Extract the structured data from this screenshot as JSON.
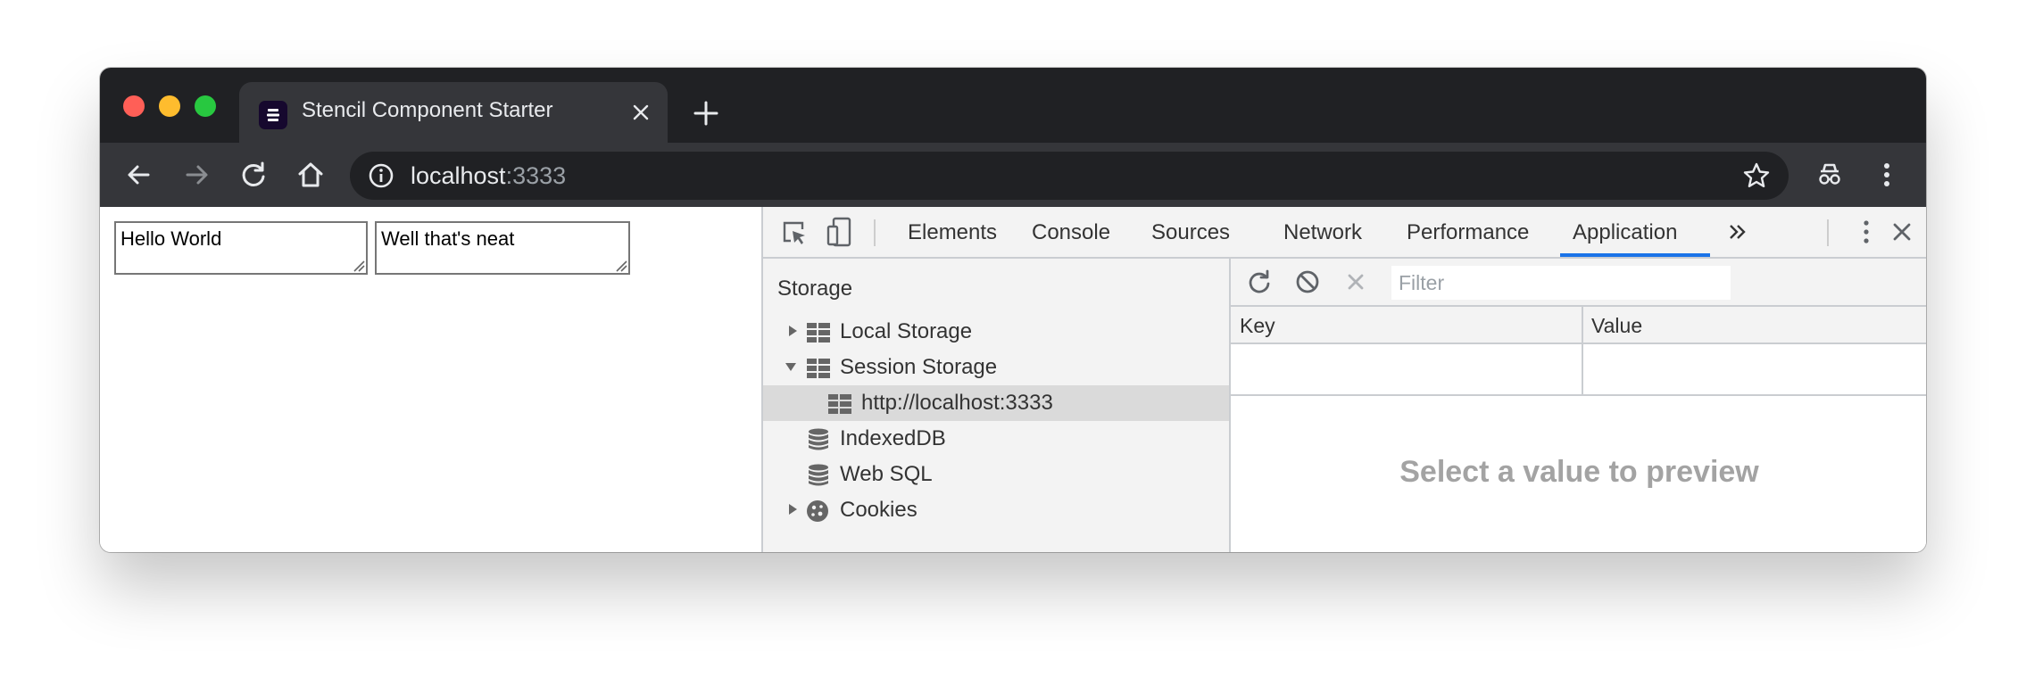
{
  "browser": {
    "tab_title": "Stencil Component Starter",
    "url_host": "localhost",
    "url_port": ":3333"
  },
  "page": {
    "textarea1_value": "Hello World",
    "textarea2_value": "Well that's neat"
  },
  "devtools": {
    "tabs": [
      "Elements",
      "Console",
      "Sources",
      "Network",
      "Performance",
      "Application"
    ],
    "active_tab": "Application",
    "sidebar": {
      "heading": "Storage",
      "items": [
        {
          "label": "Local Storage"
        },
        {
          "label": "Session Storage"
        },
        {
          "label": "http://localhost:3333"
        },
        {
          "label": "IndexedDB"
        },
        {
          "label": "Web SQL"
        },
        {
          "label": "Cookies"
        }
      ]
    },
    "filter_placeholder": "Filter",
    "columns": {
      "key": "Key",
      "value": "Value"
    },
    "preview_text": "Select a value to preview"
  },
  "colors": {
    "titlebar": "#202124",
    "toolbar": "#35363a",
    "accent": "#1a73e8"
  }
}
